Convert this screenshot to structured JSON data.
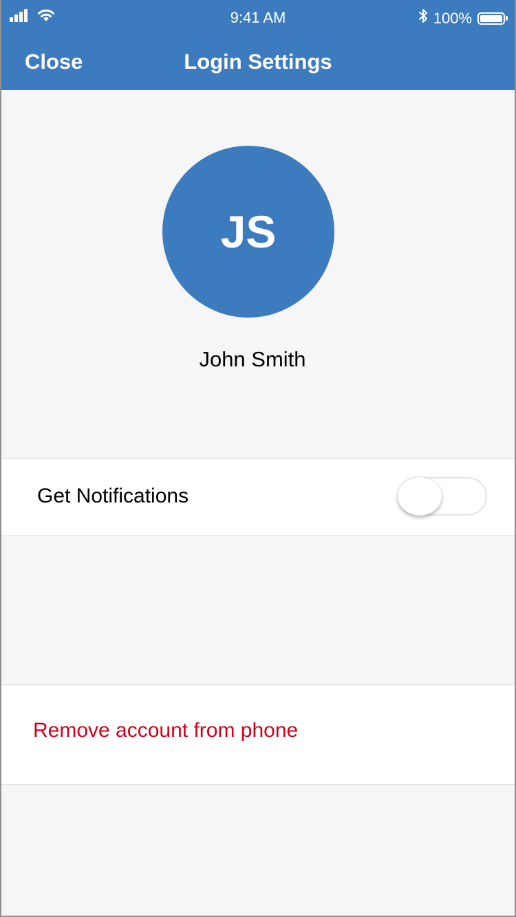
{
  "status_bar": {
    "time": "9:41 AM",
    "battery_text": "100%",
    "battery_level_fraction": 1.0,
    "icons": [
      "signal-icon",
      "wifi-icon",
      "bluetooth-icon",
      "battery-icon"
    ]
  },
  "nav": {
    "close_label": "Close",
    "title": "Login Settings"
  },
  "profile": {
    "initials": "JS",
    "name": "John Smith"
  },
  "settings": {
    "notifications_label": "Get Notifications",
    "notifications_enabled": false,
    "remove_account_label": "Remove account from phone"
  },
  "colors": {
    "brand": "#3d7bbf",
    "destructive": "#d0021b",
    "background": "#f6f6f6"
  }
}
